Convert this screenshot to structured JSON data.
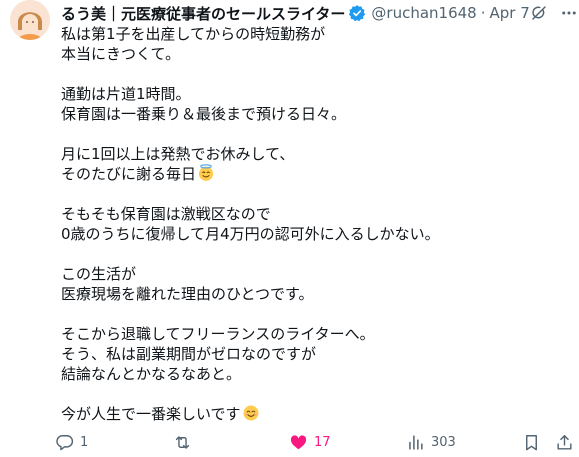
{
  "tweet": {
    "author_name": "るう美｜元医療従事者のセールスライター",
    "handle": "@ruchan1648",
    "separator": "·",
    "date": "Apr 7",
    "lines": [
      "私は第1子を出産してからの時短勤務が",
      "本当にきつくて。",
      "",
      "通勤は片道1時間。",
      "保育園は一番乗り＆最後まで預ける日々。",
      "",
      "月に1回以上は発熱でお休みして、",
      "そのたびに謝る毎日",
      "",
      "そもそも保育園は激戦区なので",
      "0歳のうちに復帰して月4万円の認可外に入るしかない。",
      "",
      "この生活が",
      "医療現場を離れた理由のひとつです。",
      "",
      "そこから退職してフリーランスのライターへ。",
      "そう、私は副業期間がゼロなのですが",
      "結論なんとかなるなあと。",
      "",
      "今が人生で一番楽しいです"
    ],
    "emojis": {
      "line_8": "smiling-face-with-halo",
      "line_20": "smiling-face-with-smiling-eyes"
    }
  },
  "actions": {
    "reply_count": "1",
    "retweet_count": "",
    "like_count": "17",
    "views_count": "303"
  },
  "colors": {
    "text": "#0f1419",
    "secondary": "#536471",
    "verified": "#1d9bf0",
    "like": "#f91880"
  },
  "icons": {
    "verified": "verified-badge-icon",
    "grok": "grok-icon",
    "more": "more-icon",
    "reply": "reply-icon",
    "retweet": "retweet-icon",
    "like": "heart-icon",
    "views": "views-icon",
    "bookmark": "bookmark-icon",
    "share": "share-icon"
  }
}
